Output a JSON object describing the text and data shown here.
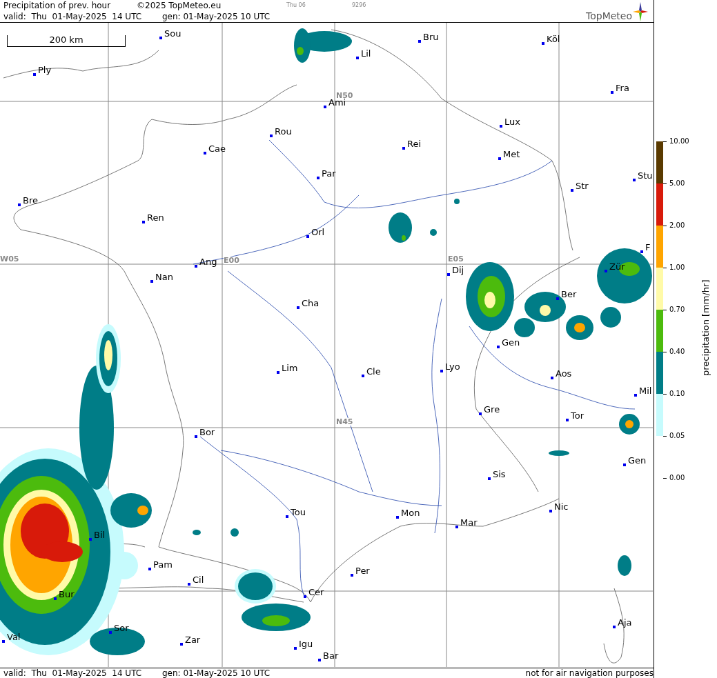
{
  "header": {
    "title": "Precipitation of prev. hour",
    "copyright": "©2025 TopMeteo.eu",
    "run_day": "Thu 06",
    "code": "9296",
    "valid": "valid:  Thu  01-May-2025  14 UTC",
    "gen": "gen: 01-May-2025 10 UTC",
    "logo": "TopMeteo"
  },
  "map": {
    "scale_label": "200 km",
    "grid_labels": [
      "N50",
      "W05",
      "E00",
      "E05",
      "N45"
    ],
    "cities": [
      "Sou",
      "Ply",
      "Lil",
      "Bru",
      "Köl",
      "Ami",
      "Fra",
      "Rou",
      "Cae",
      "Rei",
      "Lux",
      "Met",
      "Par",
      "Stu",
      "Str",
      "Bre",
      "Ren",
      "Orl",
      "F",
      "Ang",
      "Nan",
      "Dij",
      "Zür",
      "Cha",
      "Ber",
      "Gen",
      "Lim",
      "Cle",
      "Lyo",
      "Aos",
      "Mil",
      "Gre",
      "Tor",
      "Bor",
      "Gen",
      "Sis",
      "Nic",
      "Tou",
      "Mon",
      "Mar",
      "Bil",
      "Pam",
      "Per",
      "Cil",
      "Cer",
      "Bur",
      "Sor",
      "Aja",
      "Val",
      "Zar",
      "Igu",
      "Bar"
    ]
  },
  "legend": {
    "unit": "precipitation [mm/hr]",
    "ticks": [
      {
        "label": "10.00",
        "color": "#5a3a00"
      },
      {
        "label": "5.00",
        "color": "#d81a0a"
      },
      {
        "label": "2.00",
        "color": "#ffa500"
      },
      {
        "label": "1.00",
        "color": "#fffaa8"
      },
      {
        "label": "0.70",
        "color": "#4cbb0d"
      },
      {
        "label": "0.40",
        "color": "#007d87"
      },
      {
        "label": "0.10",
        "color": "#c6fbfd"
      },
      {
        "label": "0.05"
      },
      {
        "label": "0.00"
      }
    ]
  },
  "footer": {
    "valid": "valid:  Thu  01-May-2025  14 UTC",
    "gen": "gen: 01-May-2025 10 UTC",
    "note": "not for air navigation purposes"
  }
}
